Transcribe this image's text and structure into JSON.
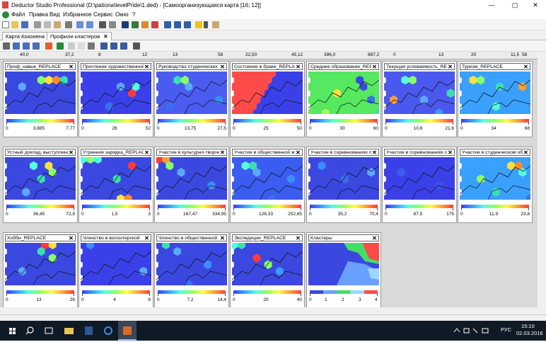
{
  "window": {
    "title": "Deductor Studio Professional (D:\\pationa\\levelPride\\1.ded) - [Самоорганизующаяся карта [16; 12]]",
    "min_glyph": "—",
    "max_glyph": "▢",
    "close_glyph": "✕"
  },
  "menu": [
    "Файл",
    "Правка",
    "Вид",
    "Избранное",
    "Сервис",
    "Окно",
    "?"
  ],
  "tabs": [
    {
      "label": "Карта Кохонена",
      "close": "✕"
    },
    {
      "label": "Профили кластеров",
      "close": "✕"
    }
  ],
  "top_strip_values": [
    "40,0",
    "37,2",
    "8",
    "12",
    "13",
    "58",
    "22,50",
    "45,12",
    "396,0",
    "687,2",
    "0",
    "13",
    "20",
    "11,5",
    "58"
  ],
  "panel_close_label": "✕",
  "panels": [
    {
      "title": "Проф_навык_REPLACE",
      "min": "0",
      "mid": "3,885",
      "max": "7,77",
      "scheme": "a"
    },
    {
      "title": "Прочтение художественной",
      "min": "0",
      "mid": "26",
      "max": "52",
      "scheme": "b"
    },
    {
      "title": "Руководство студенческих",
      "min": "0",
      "mid": "13,75",
      "max": "27,5",
      "scheme": "c"
    },
    {
      "title": "Состояние в браке_REPLACE",
      "min": "0",
      "mid": "25",
      "max": "50",
      "scheme": "d"
    },
    {
      "title": "Среднее образование_REPLACE",
      "min": "0",
      "mid": "30",
      "max": "60",
      "scheme": "e"
    },
    {
      "title": "Текущая успеваемость_REPLACE",
      "min": "0",
      "mid": "10,8",
      "max": "21,6",
      "scheme": "f"
    },
    {
      "title": "Туризм_REPLACE",
      "min": "0",
      "mid": "34",
      "max": "68",
      "scheme": "g"
    },
    {
      "title": "Устный доклад, выступление",
      "min": "0",
      "mid": "36,45",
      "max": "72,9",
      "scheme": "h"
    },
    {
      "title": "Утренняя зарядка_REPLACE",
      "min": "0",
      "mid": "1,5",
      "max": "3",
      "scheme": "i"
    },
    {
      "title": "Участие в культурно-творческой",
      "min": "0",
      "mid": "167,47",
      "max": "334,95",
      "scheme": "j"
    },
    {
      "title": "Участие в общественной жизни",
      "min": "0",
      "mid": "126,33",
      "max": "252,65",
      "scheme": "k"
    },
    {
      "title": "Участие в соревнованиях по",
      "min": "0",
      "mid": "35,2",
      "max": "70,4",
      "scheme": "l"
    },
    {
      "title": "Участие в соревнованиях о",
      "min": "0",
      "mid": "87,5",
      "max": "175",
      "scheme": "m"
    },
    {
      "title": "Участие в студенческом обществе",
      "min": "0",
      "mid": "11,9",
      "max": "23,8",
      "scheme": "n"
    },
    {
      "title": "Хобби_REPLACE",
      "min": "0",
      "mid": "13",
      "max": "26",
      "scheme": "o"
    },
    {
      "title": "Членство в волонтерской",
      "min": "0",
      "mid": "4",
      "max": "8",
      "scheme": "p"
    },
    {
      "title": "Членство в общественной",
      "min": "0",
      "mid": "7,2",
      "max": "14,4",
      "scheme": "q"
    },
    {
      "title": "Экспедиции_REPLACE",
      "min": "0",
      "mid": "20",
      "max": "40",
      "scheme": "r"
    }
  ],
  "clusters_panel": {
    "title": "Кластеры",
    "ticks": [
      "0",
      "1",
      "2",
      "3",
      "4"
    ]
  },
  "taskbar": {
    "lang": "РУС",
    "time": "15:10",
    "date": "02.03.2016"
  },
  "colors": {
    "low": "#3a3ef0",
    "mid": "#55ffdd",
    "high": "#ff3a3a",
    "taskbar": "#101a26"
  }
}
